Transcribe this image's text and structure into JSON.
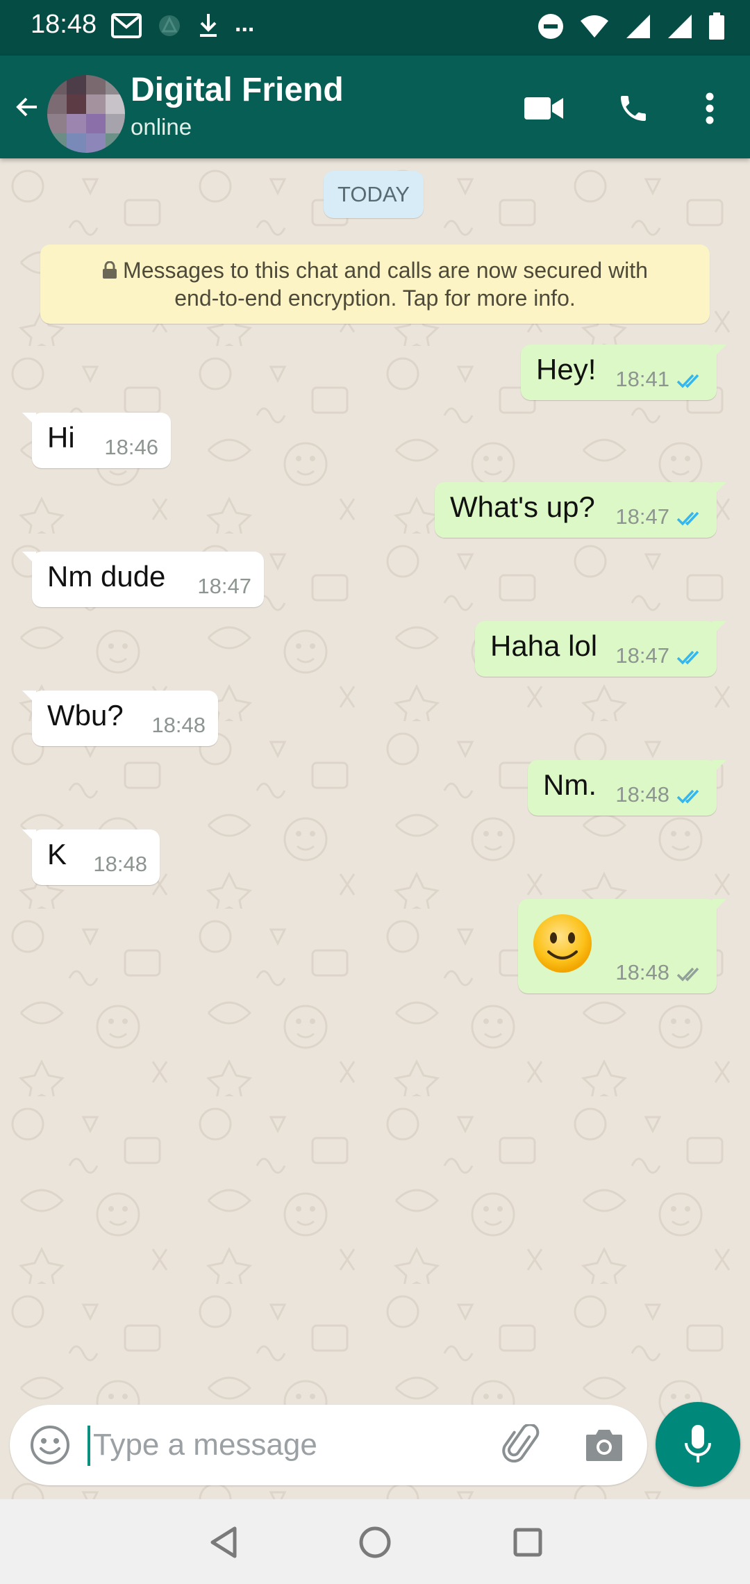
{
  "status_bar": {
    "time": "18:48",
    "left_icons": [
      "gmail-icon",
      "app-notification-icon",
      "download-icon",
      "more-notifications-icon"
    ],
    "overflow_glyph": "...",
    "right_icons": [
      "do-not-disturb-icon",
      "wifi-icon",
      "signal-icon",
      "signal-icon",
      "battery-icon"
    ]
  },
  "header": {
    "contact_name": "Digital Friend",
    "status": "online",
    "actions": [
      "video-call-icon",
      "voice-call-icon",
      "more-options-icon"
    ]
  },
  "chat": {
    "date_label": "TODAY",
    "encryption_notice_line1": "Messages to this chat and calls are now secured with",
    "encryption_notice_line2": "end-to-end encryption. Tap for more info.",
    "messages": [
      {
        "direction": "outgoing",
        "text": "Hey!",
        "time": "18:41",
        "status": "read"
      },
      {
        "direction": "incoming",
        "text": "Hi",
        "time": "18:46"
      },
      {
        "direction": "outgoing",
        "text": "What's up?",
        "time": "18:47",
        "status": "read"
      },
      {
        "direction": "incoming",
        "text": "Nm dude",
        "time": "18:47"
      },
      {
        "direction": "outgoing",
        "text": "Haha lol",
        "time": "18:47",
        "status": "read"
      },
      {
        "direction": "incoming",
        "text": "Wbu?",
        "time": "18:48"
      },
      {
        "direction": "outgoing",
        "text": "Nm.",
        "time": "18:48",
        "status": "read"
      },
      {
        "direction": "incoming",
        "text": "K",
        "time": "18:48"
      },
      {
        "direction": "outgoing",
        "text": "",
        "emoji": "slightly-smiling-face",
        "time": "18:48",
        "status": "delivered"
      }
    ]
  },
  "composer": {
    "value": "",
    "placeholder": "Type a message"
  },
  "colors": {
    "status_bar": "#054c44",
    "app_bar": "#075e54",
    "outgoing_bubble": "#dcf8c6",
    "incoming_bubble": "#ffffff",
    "read_ticks": "#34b7f1",
    "delivered_ticks": "#92a09a",
    "fab": "#00897b",
    "encryption_notice_bg": "#fdf4c5",
    "date_chip_bg": "#d7ecf6"
  },
  "nav_bar": [
    "back-triangle-icon",
    "home-circle-icon",
    "recents-square-icon"
  ]
}
